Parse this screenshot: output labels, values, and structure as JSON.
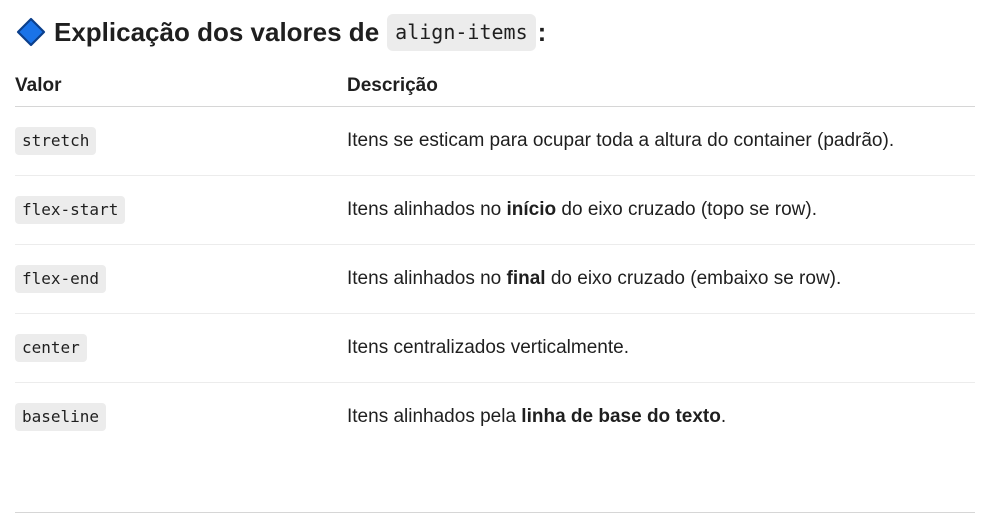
{
  "heading": {
    "text": "Explicação dos valores de",
    "code": "align-items",
    "suffix": ":",
    "icon": "blue-diamond-icon",
    "icon_color": "#1a73e8"
  },
  "table": {
    "headers": {
      "value": "Valor",
      "description": "Descrição"
    },
    "rows": [
      {
        "value": "stretch",
        "desc_before": "Itens se esticam para ocupar toda a altura do container (padrão).",
        "desc_bold": "",
        "desc_after": ""
      },
      {
        "value": "flex-start",
        "desc_before": "Itens alinhados no ",
        "desc_bold": "início",
        "desc_after": " do eixo cruzado (topo se row)."
      },
      {
        "value": "flex-end",
        "desc_before": "Itens alinhados no ",
        "desc_bold": "final",
        "desc_after": " do eixo cruzado (embaixo se row)."
      },
      {
        "value": "center",
        "desc_before": "Itens centralizados verticalmente.",
        "desc_bold": "",
        "desc_after": ""
      },
      {
        "value": "baseline",
        "desc_before": "Itens alinhados pela ",
        "desc_bold": "linha de base do texto",
        "desc_after": "."
      }
    ]
  }
}
